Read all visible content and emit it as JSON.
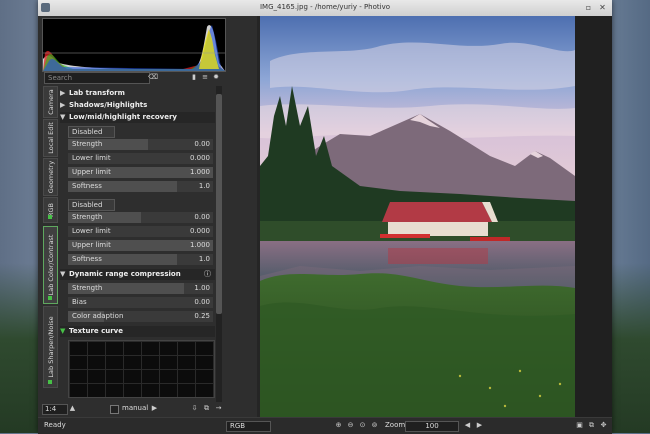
{
  "window": {
    "title": "IMG_4165.jpg - /home/yuriy - Photivo"
  },
  "search": {
    "placeholder": "Search"
  },
  "vertical_tabs": [
    "Camera",
    "Local Edit",
    "Geometry",
    "RGB",
    "Lab Color/Contrast",
    "Lab Sharpen/Noise"
  ],
  "sections": {
    "lab_transform": "Lab transform",
    "shadows_highlights": "Shadows/Highlights",
    "low_mid_high": "Low/mid/highlight recovery",
    "dynamic_range": "Dynamic range compression",
    "texture_curve": "Texture curve"
  },
  "recovery_group1": {
    "mode": "Disabled",
    "rows": [
      {
        "label": "Strength",
        "value": "0.00"
      },
      {
        "label": "Lower limit",
        "value": "0.000"
      },
      {
        "label": "Upper limit",
        "value": "1.000"
      },
      {
        "label": "Softness",
        "value": "1.0"
      }
    ]
  },
  "recovery_group2": {
    "mode": "Disabled",
    "rows": [
      {
        "label": "Strength",
        "value": "0.00"
      },
      {
        "label": "Lower limit",
        "value": "0.000"
      },
      {
        "label": "Upper limit",
        "value": "1.000"
      },
      {
        "label": "Softness",
        "value": "1.0"
      }
    ]
  },
  "dynamic_range_rows": [
    {
      "label": "Strength",
      "value": "1.00"
    },
    {
      "label": "Bias",
      "value": "0.00"
    },
    {
      "label": "Color adaption",
      "value": "0.25"
    }
  ],
  "left_bottom": {
    "zoom_ratio": "1:4",
    "manual_label": "manual"
  },
  "status": {
    "text": "Ready",
    "channel": "RGB",
    "zoom_label": "Zoom",
    "zoom_value": "100"
  },
  "colors": {
    "accent_green": "#47c047"
  }
}
